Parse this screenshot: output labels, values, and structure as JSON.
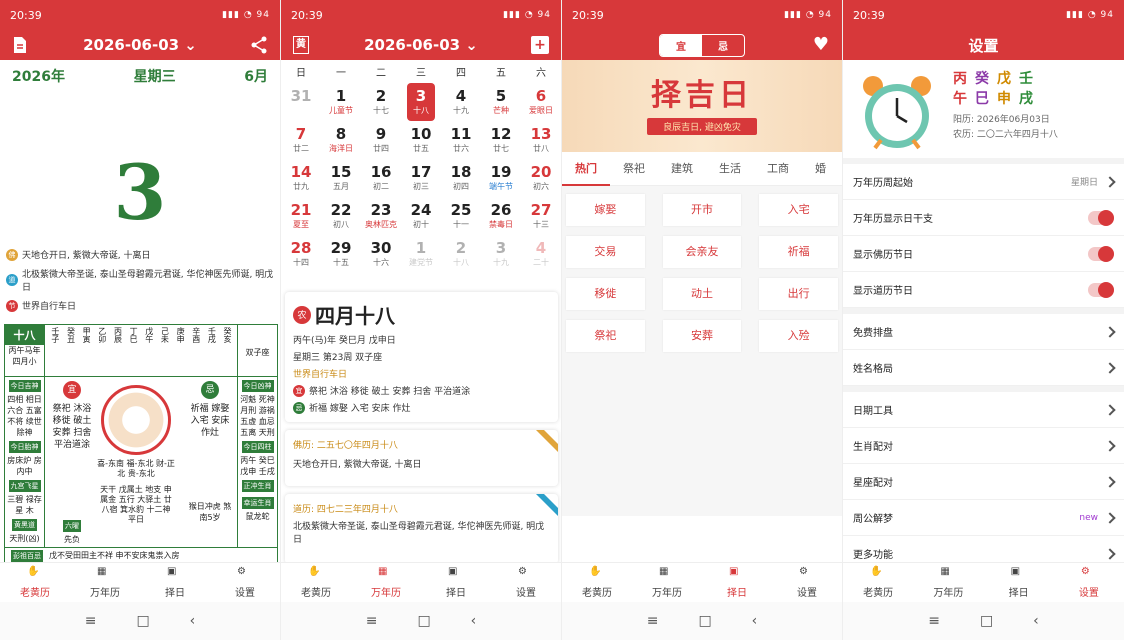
{
  "status": {
    "time": "20:39",
    "battery": "94"
  },
  "nav": [
    "老黄历",
    "万年历",
    "择日",
    "设置"
  ],
  "p1": {
    "title": "2026-06-03",
    "year": "2026年",
    "weekday": "星期三",
    "month": "6月",
    "day": "3",
    "fest": [
      {
        "icon": "佛",
        "text": "天地仓开日, 紫微大帝诞, 十离日",
        "color": "#e0a43a"
      },
      {
        "icon": "道",
        "text": "北极紫微大帝圣诞, 泰山圣母碧霞元君诞, 华佗神医先师诞, 明戊日",
        "color": "#2b9fc9"
      },
      {
        "icon": "节",
        "text": "世界自行车日",
        "color": "#d7383a"
      }
    ],
    "alm": {
      "lunar_day": "十八",
      "ganzhi": "丙午马年",
      "lunar_month": "四月小",
      "hours": [
        "壬子",
        "癸丑",
        "甲寅",
        "乙卯",
        "丙辰",
        "丁巳",
        "戊午",
        "己未",
        "庚申",
        "辛酉",
        "壬戌",
        "癸亥"
      ],
      "zodiac": "双子座",
      "left": {
        "t1": "今日吉神",
        "v1": "四相 相日 六合 五富 不将 续世 除神",
        "t2": "今日胎神",
        "v2": "房床炉 房内中",
        "t3": "九宫飞星",
        "v3": "三碧 禄存星 木",
        "t4": "黄黑道",
        "v4": "天刑(凶)",
        "t5": "六曜",
        "v5": "先负"
      },
      "yi_label": "宜",
      "yi": "祭祀 沐浴 移徙 破土 安葬 扫舍 平治道涂",
      "ji_label": "忌",
      "ji": "祈福 嫁娶 入宅 安床 作灶",
      "dirs": "喜-东南 福-东北 财-正北 贵-东北",
      "wuxing": "天干 戊属土 地支 申属金 五行 大驿土 廿八宿 箕水豹 十二神 平日",
      "chong": "猴日冲虎 煞南5岁",
      "right": {
        "t1": "今日凶神",
        "v1": "河魁 死神 月刑 游祸 五虚 血忌 五离 天刑",
        "t2": "今日四柱",
        "v2": "丙午 癸巳 戊申 壬戌",
        "t3": "正冲生肖",
        "t4": "幸运生肖",
        "v4": "鼠龙蛇"
      },
      "pengzu_label": "彭祖百忌",
      "pengzu": "戊不受田田主不祥 申不安床鬼祟入房"
    }
  },
  "p2": {
    "title": "2026-06-03",
    "week": [
      "日",
      "一",
      "二",
      "三",
      "四",
      "五",
      "六"
    ],
    "cells": [
      [
        "31",
        "",
        "dim"
      ],
      [
        "1",
        "儿童节",
        "red"
      ],
      [
        "2",
        "十七",
        ""
      ],
      [
        "3",
        "十八",
        "sel"
      ],
      [
        "4",
        "十九",
        ""
      ],
      [
        "5",
        "芒种",
        "red"
      ],
      [
        "6",
        "爱眼日",
        "red we"
      ],
      [
        "7",
        "廿二",
        "we"
      ],
      [
        "8",
        "海洋日",
        "red"
      ],
      [
        "9",
        "廿四",
        ""
      ],
      [
        "10",
        "廿五",
        ""
      ],
      [
        "11",
        "廿六",
        ""
      ],
      [
        "12",
        "廿七",
        ""
      ],
      [
        "13",
        "廿八",
        "we"
      ],
      [
        "14",
        "廿九",
        "we"
      ],
      [
        "15",
        "五月",
        ""
      ],
      [
        "16",
        "初二",
        ""
      ],
      [
        "17",
        "初三",
        ""
      ],
      [
        "18",
        "初四",
        ""
      ],
      [
        "19",
        "端午节",
        "blue"
      ],
      [
        "20",
        "初六",
        "we"
      ],
      [
        "21",
        "夏至",
        "red we"
      ],
      [
        "22",
        "初八",
        ""
      ],
      [
        "23",
        "奥林匹克",
        "red"
      ],
      [
        "24",
        "初十",
        ""
      ],
      [
        "25",
        "十一",
        ""
      ],
      [
        "26",
        "禁毒日",
        "red"
      ],
      [
        "27",
        "十三",
        "we"
      ],
      [
        "28",
        "十四",
        "we"
      ],
      [
        "29",
        "十五",
        ""
      ],
      [
        "30",
        "十六",
        ""
      ],
      [
        "1",
        "建党节",
        "dim"
      ],
      [
        "2",
        "十八",
        "dim"
      ],
      [
        "3",
        "十九",
        "dim"
      ],
      [
        "4",
        "二十",
        "dim we"
      ]
    ],
    "lunar": "四月十八",
    "line1": "丙午(马)年 癸巳月 戊申日",
    "line2": "星期三 第23周 双子座",
    "line3": "世界自行车日",
    "yi": "祭祀 沐浴 移徙 破土 安葬 扫舍 平治道涂",
    "ji": "祈福 嫁娶 入宅 安床 作灶",
    "fo_title": "佛历: 二五七〇年四月十八",
    "fo_text": "天地仓开日, 紫微大帝诞, 十离日",
    "dao_title": "道历: 四七二三年四月十八",
    "dao_text": "北极紫微大帝圣诞, 泰山圣母碧霞元君诞, 华佗神医先师诞, 明戊日"
  },
  "p3": {
    "seg": [
      "宜",
      "忌"
    ],
    "banner": "择吉日",
    "slogan": "良辰吉日, 避凶免灾",
    "tabs": [
      "热门",
      "祭祀",
      "建筑",
      "生活",
      "工商",
      "婚"
    ],
    "acts": [
      "嫁娶",
      "开市",
      "入宅",
      "交易",
      "会亲友",
      "祈福",
      "移徙",
      "动土",
      "出行",
      "祭祀",
      "安葬",
      "入殓"
    ]
  },
  "p4": {
    "title": "设置",
    "gz1": [
      "丙",
      "癸",
      "戊",
      "壬"
    ],
    "gz2": [
      "午",
      "巳",
      "申",
      "戌"
    ],
    "solar": "阳历: 2026年06月03日",
    "lunar": "农历: 二〇二六年四月十八",
    "rows1": [
      {
        "label": "万年历周起始",
        "value": "星期日",
        "kind": "chev"
      },
      {
        "label": "万年历显示日干支",
        "kind": "toggle"
      },
      {
        "label": "显示佛历节日",
        "kind": "toggle"
      },
      {
        "label": "显示道历节日",
        "kind": "toggle"
      }
    ],
    "rows2": [
      {
        "label": "免费排盘"
      },
      {
        "label": "姓名格局"
      }
    ],
    "rows3": [
      {
        "label": "日期工具",
        "value": ""
      },
      {
        "label": "生肖配对",
        "value": ""
      },
      {
        "label": "星座配对",
        "value": ""
      },
      {
        "label": "周公解梦",
        "value": "new"
      },
      {
        "label": "更多功能",
        "value": ""
      }
    ]
  }
}
